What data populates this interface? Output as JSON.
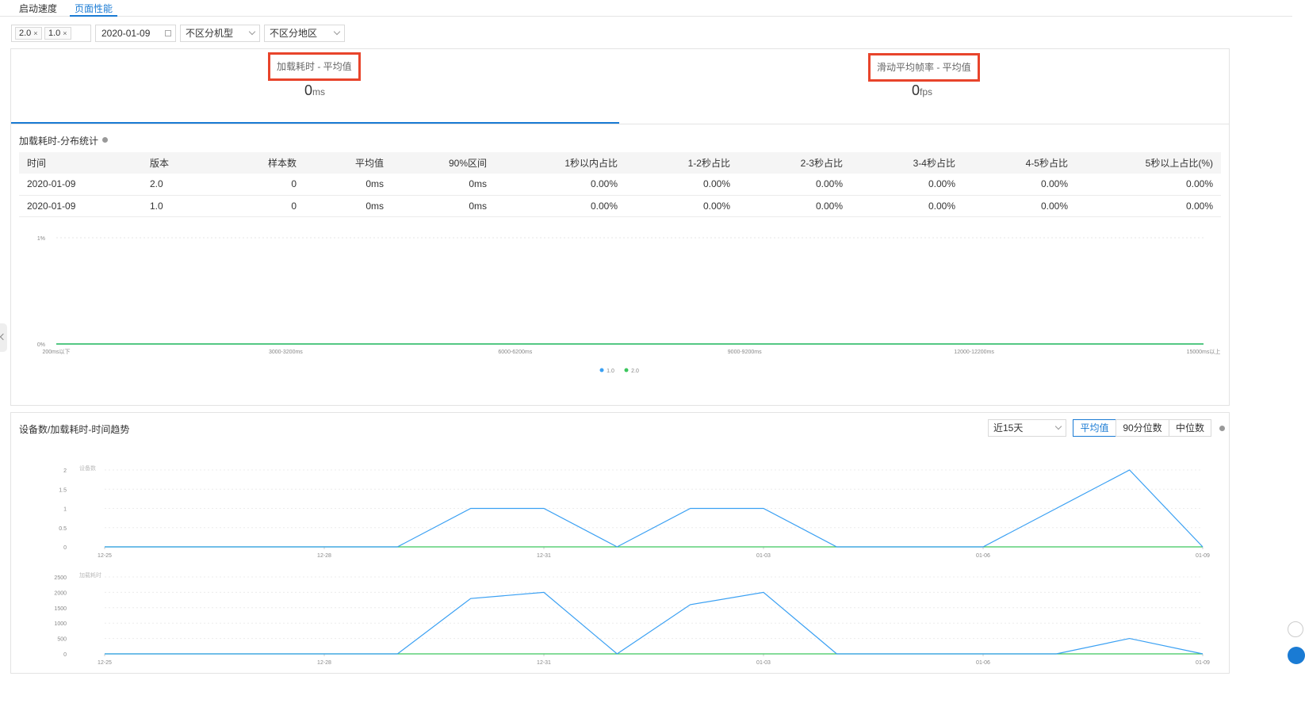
{
  "tabs": [
    {
      "label": "启动速度",
      "active": false
    },
    {
      "label": "页面性能",
      "active": true
    }
  ],
  "filters": {
    "versions": [
      "2.0",
      "1.0"
    ],
    "date": "2020-01-09",
    "device_type": "不区分机型",
    "region": "不区分地区"
  },
  "metrics": [
    {
      "label": "加载耗时 - 平均值",
      "value": "0",
      "unit": "ms"
    },
    {
      "label": "滑动平均帧率 - 平均值",
      "value": "0",
      "unit": "fps"
    }
  ],
  "distribution": {
    "title": "加载耗时-分布统计",
    "columns": [
      "时间",
      "版本",
      "样本数",
      "平均值",
      "90%区间",
      "1秒以内占比",
      "1-2秒占比",
      "2-3秒占比",
      "3-4秒占比",
      "4-5秒占比",
      "5秒以上占比(%)"
    ],
    "rows": [
      [
        "2020-01-09",
        "2.0",
        "0",
        "0ms",
        "0ms",
        "0.00%",
        "0.00%",
        "0.00%",
        "0.00%",
        "0.00%",
        "0.00%"
      ],
      [
        "2020-01-09",
        "1.0",
        "0",
        "0ms",
        "0ms",
        "0.00%",
        "0.00%",
        "0.00%",
        "0.00%",
        "0.00%",
        "0.00%"
      ]
    ]
  },
  "trend": {
    "title": "设备数/加载耗时-时间趋势",
    "range": "近15天",
    "stat_buttons": [
      {
        "label": "平均值",
        "active": true
      },
      {
        "label": "90分位数",
        "active": false
      },
      {
        "label": "中位数",
        "active": false
      }
    ]
  },
  "colors": {
    "accent": "#1a7bd4",
    "series_1_0": "#3aa0f3",
    "series_2_0": "#3cc65d",
    "highlight": "#e8442b"
  },
  "chart_data": [
    {
      "type": "line",
      "title": "",
      "x": [
        "200ms以下",
        "3000-3200ms",
        "6000-6200ms",
        "9000-9200ms",
        "12000-12200ms",
        "15000ms以上"
      ],
      "y_ticks": [
        "0%",
        "1%"
      ],
      "ylim": [
        0,
        1
      ],
      "series": [
        {
          "name": "1.0",
          "color": "#3aa0f3",
          "values": [
            0,
            0,
            0,
            0,
            0,
            0
          ]
        },
        {
          "name": "2.0",
          "color": "#3cc65d",
          "values": [
            0,
            0,
            0,
            0,
            0,
            0
          ]
        }
      ],
      "legend": "bottom-center",
      "grid": true
    },
    {
      "type": "line",
      "ylabel": "设备数",
      "x": [
        "12-25",
        "12-26",
        "12-27",
        "12-28",
        "12-29",
        "12-30",
        "12-31",
        "01-01",
        "01-02",
        "01-03",
        "01-04",
        "01-05",
        "01-06",
        "01-07",
        "01-08",
        "01-09"
      ],
      "x_tick_labels": [
        "12-25",
        "12-28",
        "12-31",
        "01-03",
        "01-06",
        "01-09"
      ],
      "y_ticks": [
        "0",
        "0.5",
        "1",
        "1.5",
        "2"
      ],
      "ylim": [
        0,
        2
      ],
      "series": [
        {
          "name": "1.0",
          "color": "#3aa0f3",
          "values": [
            0,
            0,
            0,
            0,
            0,
            1,
            1,
            0,
            1,
            1,
            0,
            0,
            0,
            1,
            2,
            0
          ]
        },
        {
          "name": "2.0",
          "color": "#3cc65d",
          "values": [
            0,
            0,
            0,
            0,
            0,
            0,
            0,
            0,
            0,
            0,
            0,
            0,
            0,
            0,
            0,
            0
          ]
        }
      ],
      "grid": true
    },
    {
      "type": "line",
      "ylabel": "加载耗时",
      "x": [
        "12-25",
        "12-26",
        "12-27",
        "12-28",
        "12-29",
        "12-30",
        "12-31",
        "01-01",
        "01-02",
        "01-03",
        "01-04",
        "01-05",
        "01-06",
        "01-07",
        "01-08",
        "01-09"
      ],
      "x_tick_labels": [
        "12-25",
        "12-28",
        "12-31",
        "01-03",
        "01-06",
        "01-09"
      ],
      "y_ticks": [
        "0",
        "500",
        "1000",
        "1500",
        "2000",
        "2500"
      ],
      "ylim": [
        0,
        2500
      ],
      "series": [
        {
          "name": "1.0",
          "color": "#3aa0f3",
          "values": [
            0,
            0,
            0,
            0,
            0,
            1800,
            2000,
            0,
            1600,
            2000,
            0,
            0,
            0,
            0,
            500,
            0
          ]
        },
        {
          "name": "2.0",
          "color": "#3cc65d",
          "values": [
            0,
            0,
            0,
            0,
            0,
            0,
            0,
            0,
            0,
            0,
            0,
            0,
            0,
            0,
            0,
            0
          ]
        }
      ],
      "grid": true
    }
  ]
}
